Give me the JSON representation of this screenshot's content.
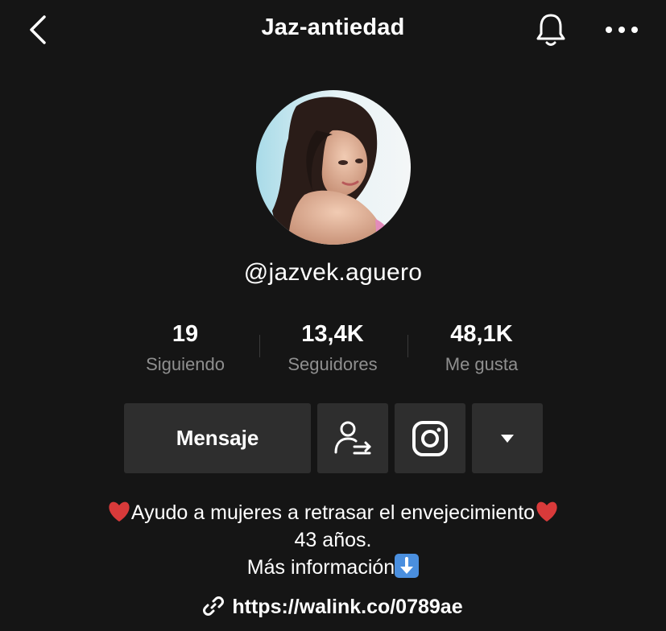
{
  "header": {
    "title": "Jaz-antiedad"
  },
  "profile": {
    "username": "@jazvek.aguero"
  },
  "stats": [
    {
      "value": "19",
      "label": "Siguiendo"
    },
    {
      "value": "13,4K",
      "label": "Seguidores"
    },
    {
      "value": "48,1K",
      "label": "Me gusta"
    }
  ],
  "actions": {
    "message_label": "Mensaje"
  },
  "bio": {
    "line1": "Ayudo a mujeres a retrasar el envejecimiento",
    "line2": "43 años.",
    "line3": "Más información",
    "link": "https://walink.co/0789ae"
  },
  "icons": {
    "back": "chevron-left-icon",
    "bell": "bell-icon",
    "more": "more-horizontal-icon",
    "follow_switch": "user-switch-icon",
    "instagram": "instagram-icon",
    "dropdown": "caret-down-icon",
    "link": "link-icon",
    "heart": "red-heart-emoji",
    "down_arrow": "down-arrow-emoji"
  },
  "colors": {
    "background": "#151515",
    "button": "#2e2e2e",
    "muted_text": "#8f8f8f",
    "heart": "#d93a3a",
    "emoji_blue": "#4a8fdf"
  }
}
